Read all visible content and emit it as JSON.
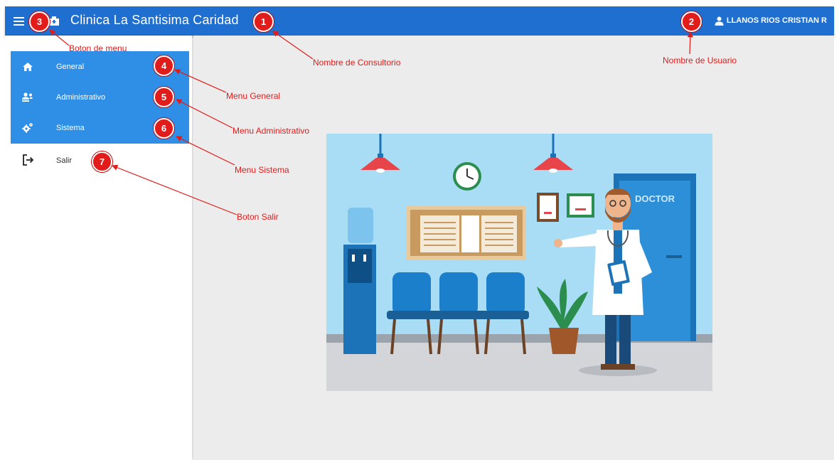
{
  "appbar": {
    "title": "Clinica La Santisima Caridad",
    "user_name": "LLANOS RIOS CRISTIAN R",
    "menu_icon": "hamburger-icon",
    "clinic_icon": "clinic-icon",
    "user_icon": "user-icon",
    "color": "#1e6fd0"
  },
  "sidebar": {
    "accent": "#2f8fe6",
    "items": [
      {
        "label": "General",
        "icon": "home-icon"
      },
      {
        "label": "Administrativo",
        "icon": "users-icon"
      },
      {
        "label": "Sistema",
        "icon": "gears-icon"
      }
    ],
    "exit": {
      "label": "Salir",
      "icon": "exit-icon"
    }
  },
  "illustration": {
    "door_label": "DOCTOR"
  },
  "annotations": [
    {
      "number": "1",
      "text": "Nombre de Consultorio"
    },
    {
      "number": "2",
      "text": "Nombre de Usuario"
    },
    {
      "number": "3",
      "text": "Boton de menu"
    },
    {
      "number": "4",
      "text": "Menu General"
    },
    {
      "number": "5",
      "text": "Menu Administrativo"
    },
    {
      "number": "6",
      "text": "Menu Sistema"
    },
    {
      "number": "7",
      "text": "Boton Salir"
    }
  ],
  "colors": {
    "annotation": "#e21b1b",
    "background": "#ececec"
  }
}
